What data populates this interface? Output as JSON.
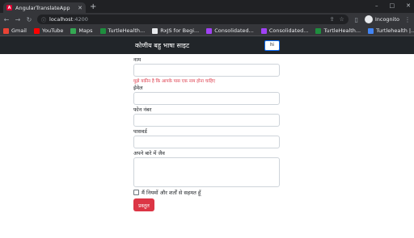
{
  "browser": {
    "tab_title": "AngularTranslateApp",
    "tab_close": "✕",
    "new_tab": "+",
    "window_controls": [
      "–",
      "□",
      "✕"
    ],
    "url_host": "localhost",
    "url_port": ":4200",
    "profile": "Incognito",
    "bookmarks": [
      {
        "label": "Gmail",
        "color": "#ea4335"
      },
      {
        "label": "YouTube",
        "color": "#ff0000"
      },
      {
        "label": "Maps",
        "color": "#34a853"
      },
      {
        "label": "TurtleHealth...",
        "color": "#1e8e3e"
      },
      {
        "label": "RxJS for Begi...",
        "color": "#e8eaed"
      },
      {
        "label": "Consolidated...",
        "color": "#a142f4"
      },
      {
        "label": "Consolidated...",
        "color": "#a142f4"
      },
      {
        "label": "TurtleHealth...",
        "color": "#1e8e3e"
      },
      {
        "label": "Turtlehealth |...",
        "color": "#4285f4"
      }
    ]
  },
  "app": {
    "brand": "कोणीय बहु भाषा साइट",
    "lang_button": "hi",
    "form": {
      "name_label": "नाम",
      "name_error": "मुझे यकीन है कि आपके पास एक नाम होना चाहिए",
      "email_label": "ईमेल",
      "phone_label": "फोन नंबर",
      "password_label": "पासवर्ड",
      "about_label": "अपने बारे में जैव",
      "agree_label": "मैं नियमों और शर्तों से सहमत हूँ",
      "submit_label": "प्रस्तुत"
    }
  },
  "colors": {
    "navbar": "#212529",
    "submit": "#dc3545",
    "error": "#dc3545"
  }
}
